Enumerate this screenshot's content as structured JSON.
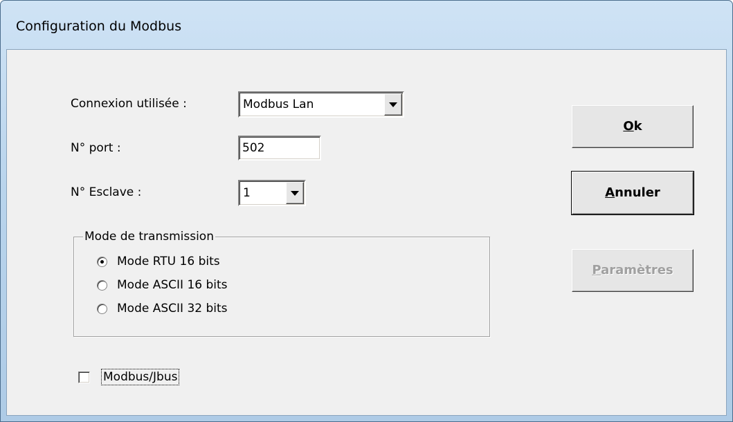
{
  "window": {
    "title": "Configuration du Modbus"
  },
  "form": {
    "connexion_label": "Connexion utilisée :",
    "connexion_value": "Modbus Lan",
    "port_label": "N° port :",
    "port_value": "502",
    "esclave_label": "N° Esclave :",
    "esclave_value": "1"
  },
  "transmission": {
    "legend": "Mode de transmission",
    "options": [
      {
        "label": "Mode RTU 16 bits",
        "checked": true
      },
      {
        "label": "Mode ASCII 16 bits",
        "checked": false
      },
      {
        "label": "Mode ASCII 32 bits",
        "checked": false
      }
    ]
  },
  "jbus": {
    "label": "Modbus/Jbus",
    "checked": false
  },
  "buttons": {
    "ok_mnemonic": "O",
    "ok_rest": "k",
    "cancel_mnemonic": "A",
    "cancel_rest": "nnuler",
    "params_mnemonic": "P",
    "params_rest": "aramètres"
  }
}
